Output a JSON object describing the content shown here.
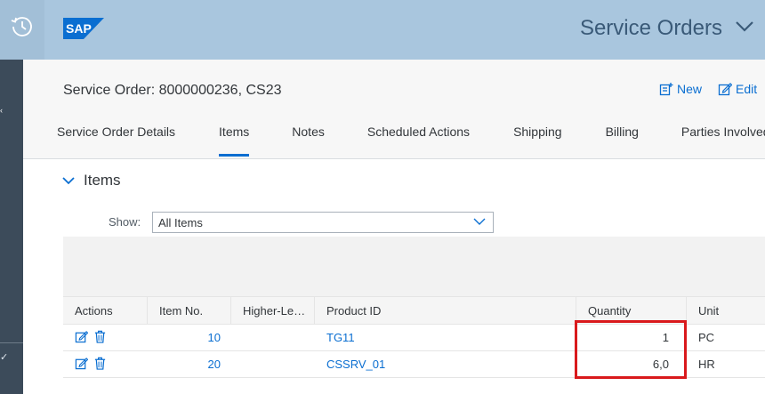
{
  "shell": {
    "title": "Service Orders",
    "logo_text": "SAP",
    "brand_color": "#0a6ed1"
  },
  "header": {
    "object_title": "Service Order: 8000000236, CS23",
    "new_label": "New",
    "edit_label": "Edit",
    "tabs": [
      {
        "label": "Service Order Details",
        "active": false
      },
      {
        "label": "Items",
        "active": true
      },
      {
        "label": "Notes",
        "active": false
      },
      {
        "label": "Scheduled Actions",
        "active": false
      },
      {
        "label": "Shipping",
        "active": false
      },
      {
        "label": "Billing",
        "active": false
      },
      {
        "label": "Parties Involved",
        "active": false
      }
    ]
  },
  "section": {
    "title": "Items",
    "show_label": "Show:",
    "show_value": "All Items"
  },
  "table": {
    "columns": [
      "Actions",
      "Item No.",
      "Higher-Le…",
      "Product ID",
      "Quantity",
      "Unit"
    ],
    "rows": [
      {
        "item_no": "10",
        "higher_level": "",
        "product_id": "TG11",
        "quantity": "1",
        "unit": "PC"
      },
      {
        "item_no": "20",
        "higher_level": "",
        "product_id": "CSSRV_01",
        "quantity": "6,0",
        "unit": "HR"
      }
    ]
  },
  "icons": {
    "history": "history-icon",
    "chevron": "chevron-down-icon",
    "new": "create-icon",
    "edit": "edit-icon",
    "row_edit": "edit-icon",
    "row_delete": "delete-icon"
  },
  "highlight_color": "#d9191c"
}
